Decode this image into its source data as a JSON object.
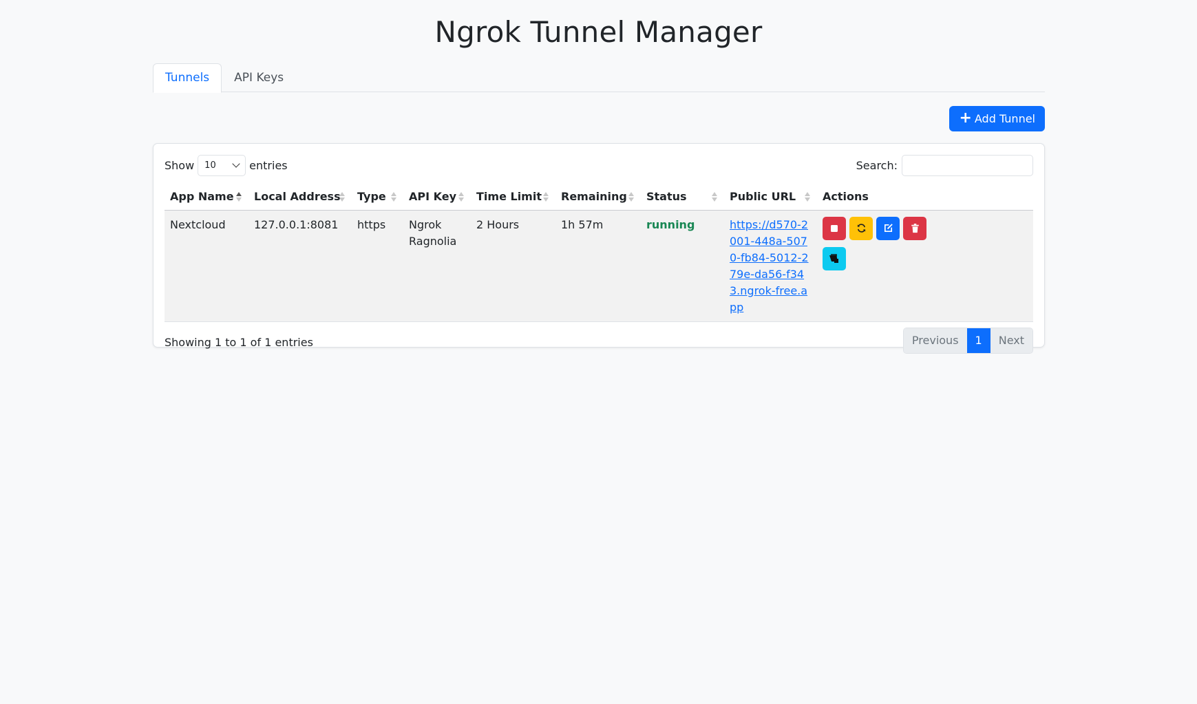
{
  "header": {
    "title": "Ngrok Tunnel Manager"
  },
  "tabs": [
    {
      "label": "Tunnels",
      "active": true
    },
    {
      "label": "API Keys",
      "active": false
    }
  ],
  "toolbar": {
    "add_label": "Add Tunnel",
    "add_icon": "plus-icon"
  },
  "table_controls": {
    "show_label": "Show",
    "page_size": "10",
    "entries_label": "entries",
    "search_label": "Search:",
    "search_value": ""
  },
  "table": {
    "columns": [
      "App Name",
      "Local Address",
      "Type",
      "API Key",
      "Time Limit",
      "Remaining",
      "Status",
      "Public URL",
      "Actions"
    ],
    "rows": [
      {
        "app_name": "Nextcloud",
        "local_address": "127.0.0.1:8081",
        "type": "https",
        "api_key": "Ngrok Ragnolia",
        "time_limit": "2 Hours",
        "remaining": "1h 57m",
        "status": "running",
        "public_url": "https://d570-2001-448a-5070-fb84-5012-279e-da56-f343.ngrok-free.app",
        "actions": [
          "stop-icon",
          "restart-icon",
          "edit-icon",
          "trash-icon",
          "terminal-icon"
        ]
      }
    ]
  },
  "footer": {
    "info": "Showing 1 to 1 of 1 entries",
    "prev_label": "Previous",
    "current_page": "1",
    "next_label": "Next"
  },
  "colors": {
    "primary": "#0d6efd",
    "danger": "#dc3545",
    "warning": "#ffc107",
    "info": "#0dcaf0",
    "success": "#198754"
  }
}
